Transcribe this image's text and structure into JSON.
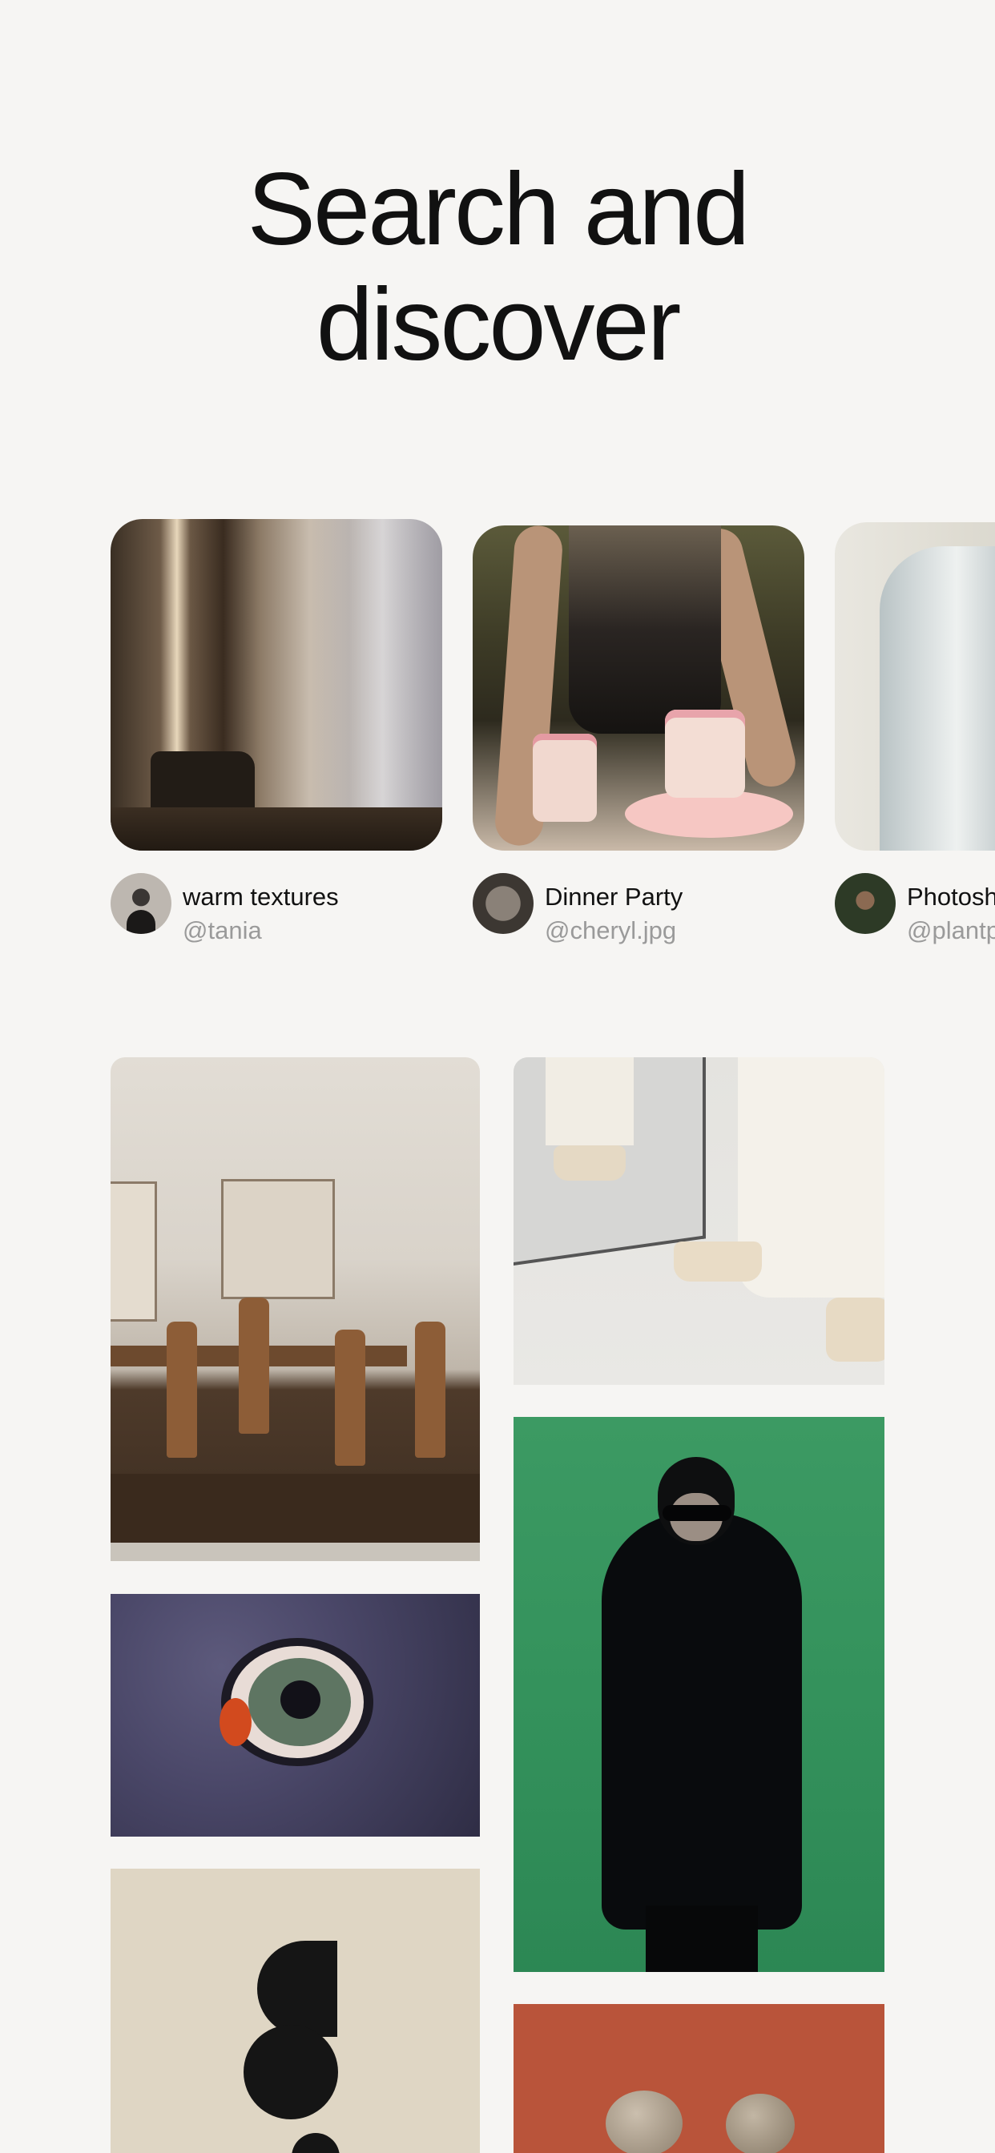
{
  "hero": {
    "title_line1": "Search and",
    "title_line2": "discover"
  },
  "collections": [
    {
      "title": "warm textures",
      "handle": "@tania"
    },
    {
      "title": "Dinner Party",
      "handle": "@cheryl.jpg"
    },
    {
      "title": "Photosh",
      "handle": "@plantp"
    }
  ],
  "feed": {
    "tiles": [
      "dining-room",
      "white-boots-mirror",
      "eye-painting",
      "green-portrait",
      "moon-phases-poster",
      "stones-on-orange"
    ]
  },
  "colors": {
    "background": "#f6f5f3",
    "text_primary": "#111111",
    "text_secondary": "#9a9a9a"
  }
}
